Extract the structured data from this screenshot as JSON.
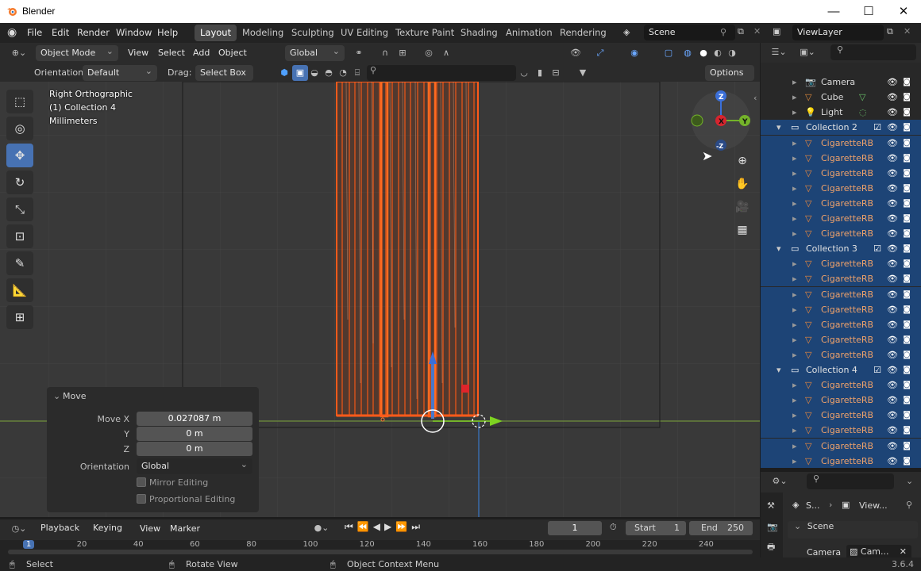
{
  "window": {
    "title": "Blender",
    "min": "—",
    "max": "☐",
    "close": "✕"
  },
  "menu": [
    "File",
    "Edit",
    "Render",
    "Window",
    "Help"
  ],
  "workspaces": [
    "Layout",
    "Modeling",
    "Sculpting",
    "UV Editing",
    "Texture Paint",
    "Shading",
    "Animation",
    "Rendering"
  ],
  "scene": {
    "name": "Scene",
    "viewlayer": "ViewLayer"
  },
  "header": {
    "mode": "Object Mode",
    "view": "View",
    "select": "Select",
    "add": "Add",
    "object": "Object",
    "transform": "Global"
  },
  "tool_settings": {
    "orientation_label": "Orientation:",
    "orientation": "Default",
    "drag_label": "Drag:",
    "drag": "Select Box",
    "options": "Options"
  },
  "overlay_info": {
    "view": "Right Orthographic",
    "collection": "(1) Collection 4",
    "units": "Millimeters"
  },
  "redo_panel": {
    "title": "Move",
    "move_x_label": "Move X",
    "move_x": "0.027087 m",
    "y_label": "Y",
    "y": "0 m",
    "z_label": "Z",
    "z": "0 m",
    "orientation_label": "Orientation",
    "orientation": "Global",
    "mirror": "Mirror Editing",
    "proportional": "Proportional Editing"
  },
  "outliner": {
    "top_items": [
      {
        "name": "Camera"
      },
      {
        "name": "Cube"
      },
      {
        "name": "Light"
      }
    ],
    "collections": [
      {
        "name": "Collection 2",
        "items": [
          "CigaretteRB",
          "CigaretteRB",
          "CigaretteRB",
          "CigaretteRB",
          "CigaretteRB",
          "CigaretteRB",
          "CigaretteRB"
        ]
      },
      {
        "name": "Collection 3",
        "items": [
          "CigaretteRB",
          "CigaretteRB",
          "CigaretteRB",
          "CigaretteRB",
          "CigaretteRB",
          "CigaretteRB",
          "CigaretteRB"
        ]
      },
      {
        "name": "Collection 4",
        "items": [
          "CigaretteRB",
          "CigaretteRB",
          "CigaretteRB",
          "CigaretteRB",
          "CigaretteRB",
          "CigaretteRB"
        ]
      }
    ]
  },
  "properties": {
    "breadcrumb_scene": "S...",
    "breadcrumb_view": "View...",
    "panel": "Scene",
    "camera_label": "Camera",
    "camera_value": "Cam..."
  },
  "timeline": {
    "playback": "Playback",
    "keying": "Keying",
    "view": "View",
    "marker": "Marker",
    "frame": "1",
    "start_label": "Start",
    "start": "1",
    "end_label": "End",
    "end": "250",
    "ticks": [
      "1",
      "20",
      "40",
      "60",
      "80",
      "100",
      "120",
      "140",
      "160",
      "180",
      "200",
      "220",
      "240"
    ]
  },
  "status": {
    "select": "Select",
    "rotate": "Rotate View",
    "context": "Object Context Menu",
    "version": "3.6.4"
  },
  "gizmo": {
    "z": "Z",
    "y": "Y",
    "x": "X",
    "neg_z": "-Z"
  }
}
